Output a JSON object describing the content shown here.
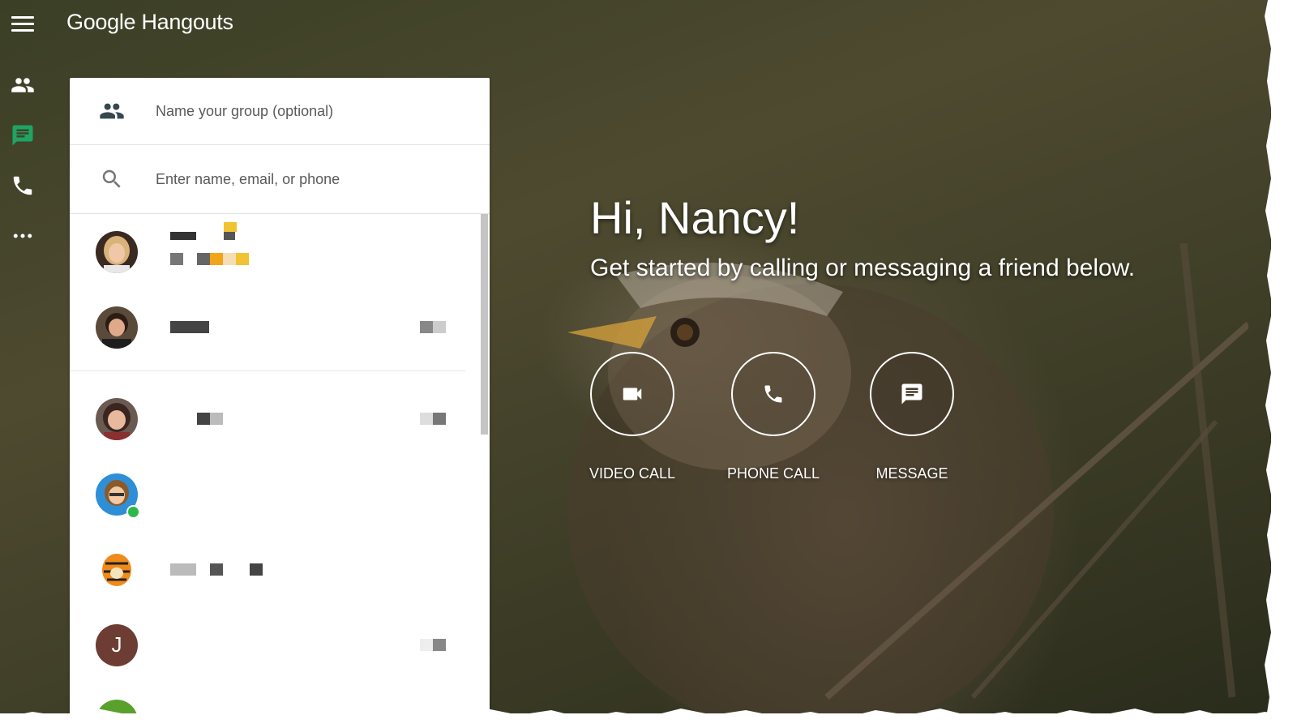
{
  "app": {
    "title": "Google Hangouts"
  },
  "rail": {
    "items": [
      {
        "icon": "contacts-icon",
        "label": "Contacts"
      },
      {
        "icon": "chat-icon",
        "label": "Conversations",
        "active": true
      },
      {
        "icon": "phone-icon",
        "label": "Phone calls"
      },
      {
        "icon": "more-icon",
        "label": "More"
      }
    ],
    "active_color": "#1fa463"
  },
  "panel": {
    "group_name": {
      "placeholder": "Name your group (optional)",
      "icon": "group-icon"
    },
    "search": {
      "placeholder": "Enter name, email, or phone",
      "icon": "search-icon"
    },
    "contacts": [
      {
        "avatar": "photo-blonde-woman",
        "name": "Bonnie Mo...",
        "redacted": true
      },
      {
        "avatar": "photo-dark-hair-woman",
        "redacted": true
      },
      {
        "avatar": "photo-smiling-woman",
        "redacted": true
      },
      {
        "avatar": "cartoon-avatar",
        "online": true,
        "redacted": true
      },
      {
        "avatar": "tigger-image",
        "redacted": true
      },
      {
        "avatar": "letter-avatar",
        "initial": "J",
        "redacted": true
      },
      {
        "avatar": "green-avatar",
        "redacted": true
      }
    ]
  },
  "hero": {
    "greeting": "Hi, Nancy!",
    "subtitle": "Get started by calling or messaging a friend below.",
    "actions": [
      {
        "icon": "video-camera-icon",
        "label": "VIDEO CALL"
      },
      {
        "icon": "phone-icon",
        "label": "PHONE CALL"
      },
      {
        "icon": "message-icon",
        "label": "MESSAGE"
      }
    ]
  },
  "colors": {
    "online": "#2db84b",
    "letter_avatar_bg": "#6d3d33",
    "redaction_accent": "#f1a51a"
  }
}
